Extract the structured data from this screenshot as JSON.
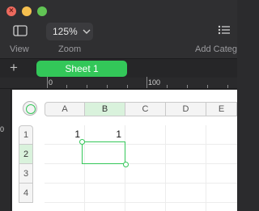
{
  "window": {
    "close_glyph": "×"
  },
  "toolbar": {
    "view_label": "View",
    "zoom_value": "125%",
    "zoom_label": "Zoom",
    "add_category_label": "Add Categ"
  },
  "sheets": {
    "add_glyph": "+",
    "tabs": [
      {
        "label": "Sheet 1",
        "active": true
      }
    ]
  },
  "ruler": {
    "top_labels": [
      "0",
      "100"
    ],
    "left_label": "0"
  },
  "table": {
    "columns": [
      "A",
      "B",
      "C",
      "D",
      "E"
    ],
    "active_column": "B",
    "rows": [
      "1",
      "2",
      "3",
      "4"
    ],
    "active_row": "2",
    "cells": {
      "A1": "1",
      "B1": "1"
    },
    "selected_cell": "B2"
  },
  "colors": {
    "accent": "#34c759",
    "selection_header": "#d9f2dc"
  },
  "icons": {
    "view": "sidebar-icon",
    "zoom": "chevron-down-icon",
    "add_category": "list-icon",
    "select_all": "circle-select-icon"
  }
}
